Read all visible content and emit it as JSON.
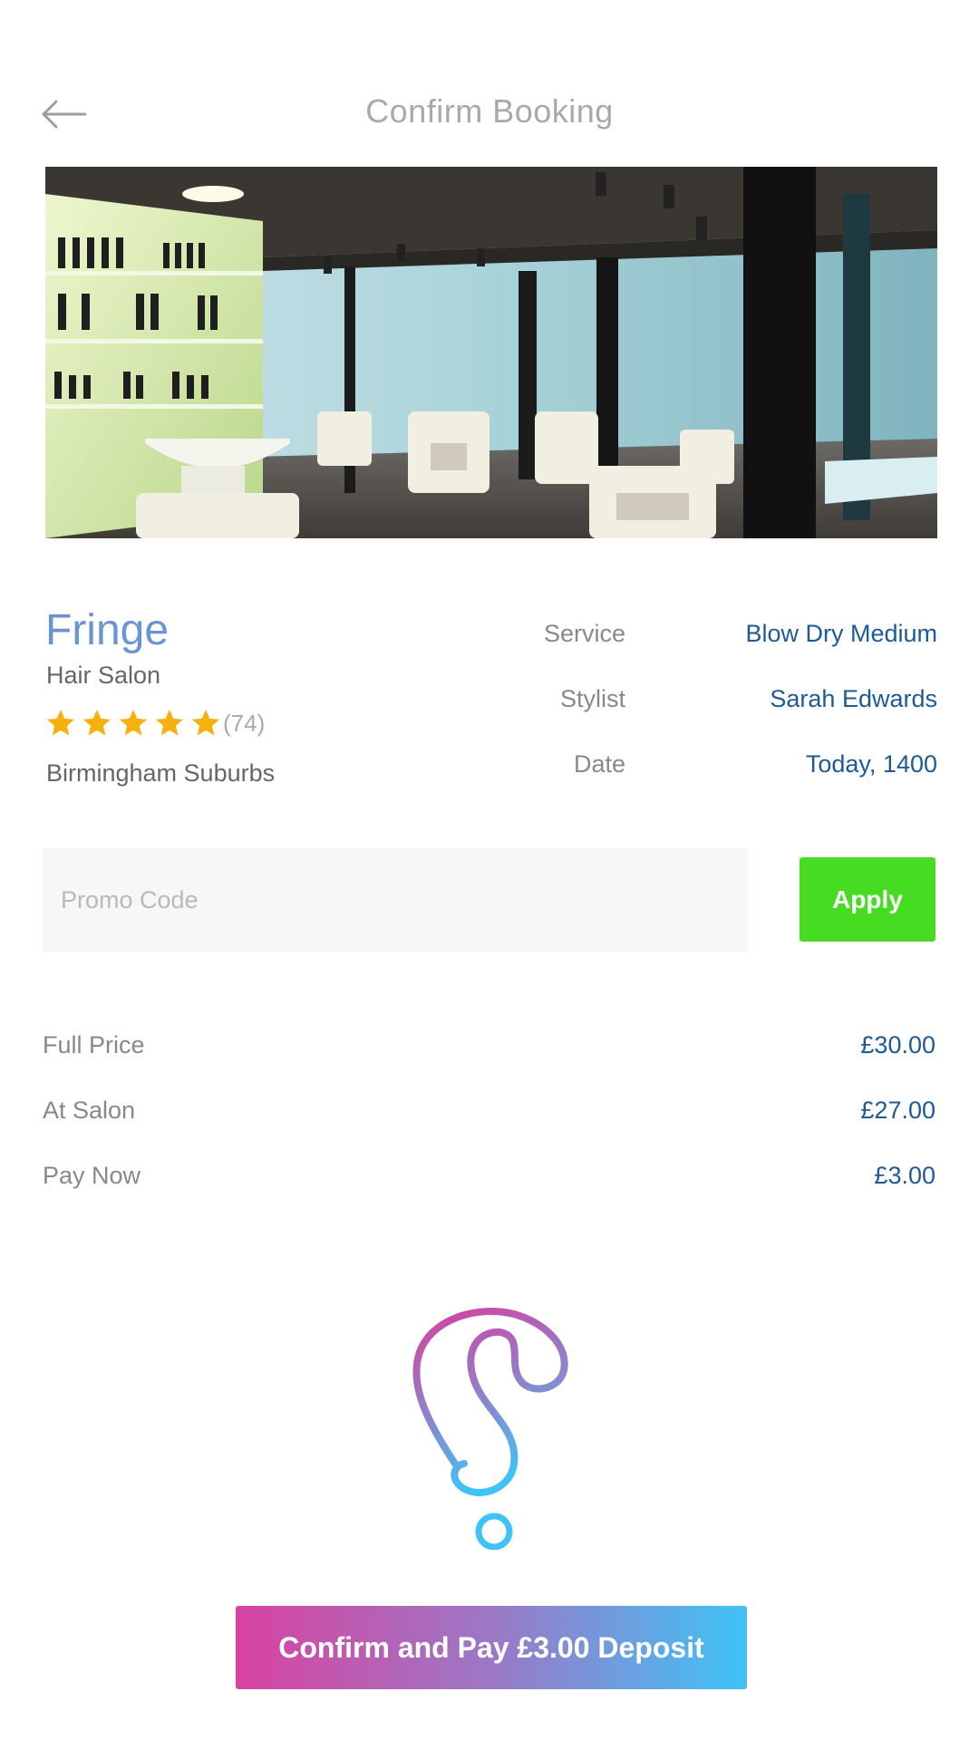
{
  "header": {
    "title": "Confirm Booking",
    "back_icon": "arrow-left-icon"
  },
  "salon": {
    "name": "Fringe",
    "type": "Hair Salon",
    "rating_stars": 5,
    "review_count": "(74)",
    "location": "Birmingham Suburbs",
    "star_color": "#f5b20f"
  },
  "details": [
    {
      "label": "Service",
      "value": "Blow Dry Medium"
    },
    {
      "label": "Stylist",
      "value": "Sarah Edwards"
    },
    {
      "label": "Date",
      "value": "Today, 1400"
    }
  ],
  "promo": {
    "placeholder": "Promo Code",
    "value": "",
    "apply_label": "Apply"
  },
  "prices": [
    {
      "label": "Full Price",
      "value": "£30.00"
    },
    {
      "label": "At Salon",
      "value": "£27.00"
    },
    {
      "label": "Pay Now",
      "value": "£3.00"
    }
  ],
  "footer": {
    "logo_icon": "brand-logo-icon",
    "confirm_label": "Confirm and Pay £3.00 Deposit"
  },
  "colors": {
    "accent_blue": "#6b93d6",
    "value_blue": "#1e5a96",
    "apply_green": "#46dc22",
    "gradient_start": "#d843a0",
    "gradient_end": "#3fc3f6"
  }
}
